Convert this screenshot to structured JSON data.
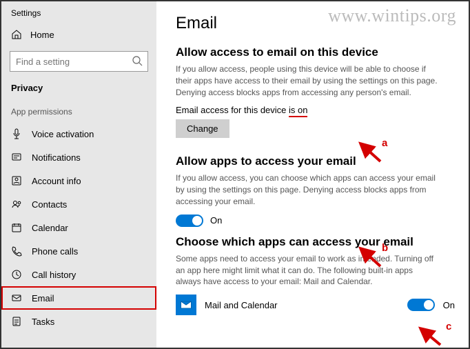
{
  "app": {
    "name": "Settings"
  },
  "watermark": "www.wintips.org",
  "sidebar": {
    "home": "Home",
    "search_placeholder": "Find a setting",
    "section": "Privacy",
    "subsection": "App permissions",
    "items": [
      {
        "label": "Voice activation"
      },
      {
        "label": "Notifications"
      },
      {
        "label": "Account info"
      },
      {
        "label": "Contacts"
      },
      {
        "label": "Calendar"
      },
      {
        "label": "Phone calls"
      },
      {
        "label": "Call history"
      },
      {
        "label": "Email",
        "selected": true
      },
      {
        "label": "Tasks"
      }
    ]
  },
  "main": {
    "title": "Email",
    "g1": {
      "heading": "Allow access to email on this device",
      "desc": "If you allow access, people using this device will be able to choose if their apps have access to their email by using the settings on this page. Denying access blocks apps from accessing any person's email.",
      "status_prefix": "Email access for this device ",
      "status_value": "is on",
      "button": "Change"
    },
    "g2": {
      "heading": "Allow apps to access your email",
      "desc": "If you allow access, you can choose which apps can access your email by using the settings on this page. Denying access blocks apps from accessing your email.",
      "toggle": "On"
    },
    "g3": {
      "heading": "Choose which apps can access your email",
      "desc": "Some apps need to access your email to work as intended. Turning off an app here might limit what it can do. The following built-in apps always have access to your email: Mail and Calendar.",
      "app": {
        "name": "Mail and Calendar",
        "toggle": "On"
      }
    }
  },
  "annot": {
    "a": "a",
    "b": "b",
    "c": "c"
  }
}
